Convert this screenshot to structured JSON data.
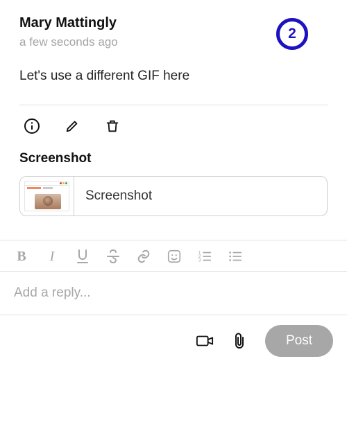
{
  "comment": {
    "author": "Mary Mattingly",
    "time": "a few seconds ago",
    "body": "Let's use a different GIF here",
    "count": "2"
  },
  "attachment": {
    "section_title": "Screenshot",
    "label": "Screenshot"
  },
  "toolbar": {
    "bold": "B",
    "italic": "I",
    "underline": "U",
    "strike": "S"
  },
  "reply": {
    "placeholder": "Add a reply..."
  },
  "post_button": "Post"
}
